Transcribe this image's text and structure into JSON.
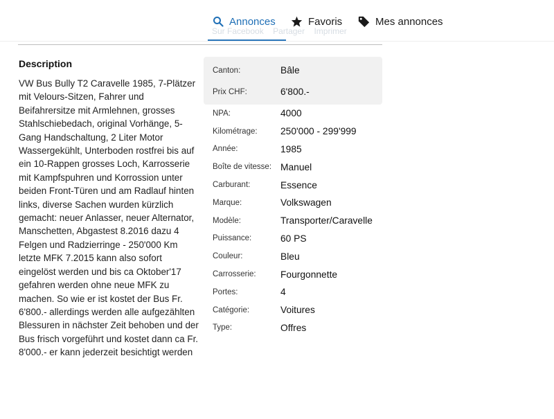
{
  "nav": {
    "tabs": [
      {
        "label": "Annonces",
        "icon": "search-icon",
        "active": true
      },
      {
        "label": "Favoris",
        "icon": "star-icon",
        "active": false
      },
      {
        "label": "Mes annonces",
        "icon": "tag-icon",
        "active": false
      }
    ],
    "ghost_actions": [
      "Sur Facebook",
      "Partager",
      "Imprimer"
    ],
    "accent_color": "#1f6fb6"
  },
  "description": {
    "heading": "Description",
    "text": "VW Bus Bully T2 Caravelle 1985, 7-Plätzer mit Velours-Sitzen, Fahrer und Beifahrersitze mit Armlehnen, grosses Stahlschiebedach, original Vorhänge, 5-Gang Handschaltung, 2 Liter Motor Wassergekühlt, Unterboden rostfrei bis auf ein 10-Rappen grosses Loch, Karrosserie mit Kampfspuhren und Korrossion unter beiden Front-Türen und am Radlauf hinten links, diverse Sachen wurden kürzlich gemacht: neuer Anlasser, neuer Alternator, Manschetten, Abgastest 8.2016 dazu 4 Felgen und Radzierringe - 250'000 Km letzte MFK 7.2015 kann also sofort eingelöst werden und bis ca Oktober'17 gefahren werden ohne neue MFK zu machen. So wie er ist kostet der Bus Fr. 6'800.- allerdings werden alle aufgezählten Blessuren in nächster Zeit behoben und der Bus frisch vorgeführt und kostet dann ca Fr. 8'000.- er kann jederzeit besichtigt werden"
  },
  "details": {
    "highlighted": [
      {
        "label": "Canton:",
        "value": "Bâle"
      },
      {
        "label": "Prix CHF:",
        "value": "6'800.-"
      }
    ],
    "rows": [
      {
        "label": "NPA:",
        "value": "4000"
      },
      {
        "label": "Kilométrage:",
        "value": "250'000 - 299'999"
      },
      {
        "label": "Année:",
        "value": "1985"
      },
      {
        "label": "Boîte de vitesse:",
        "value": "Manuel"
      },
      {
        "label": "Carburant:",
        "value": "Essence"
      },
      {
        "label": "Marque:",
        "value": "Volkswagen"
      },
      {
        "label": "Modèle:",
        "value": "Transporter/Caravelle"
      },
      {
        "label": "Puissance:",
        "value": "60 PS"
      },
      {
        "label": "Couleur:",
        "value": "Bleu"
      },
      {
        "label": "Carrosserie:",
        "value": "Fourgonnette"
      },
      {
        "label": "Portes:",
        "value": "4"
      },
      {
        "label": "Catégorie:",
        "value": "Voitures"
      },
      {
        "label": "Type:",
        "value": "Offres"
      }
    ]
  }
}
